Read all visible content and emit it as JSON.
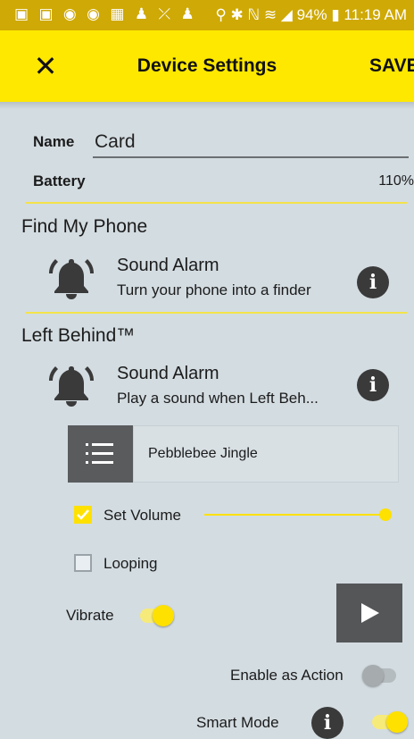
{
  "status_bar": {
    "left_icons": "▣ ▣ ◉ ◉ ▦ ♟ ⤫ ♟",
    "right_text": "⚲ ✱ ℕ ≋ ◢ 94% ▮ 11:19 AM",
    "color": "#cfa905"
  },
  "app_bar": {
    "close_icon": "✕",
    "title": "Device Settings",
    "save_label": "SAVE",
    "color": "#ffe800"
  },
  "device": {
    "name_label": "Name",
    "name_value": "Card",
    "battery_label": "Battery",
    "battery_value": "110%"
  },
  "find_my_phone": {
    "title": "Find My Phone",
    "alarm_title": "Sound Alarm",
    "alarm_subtitle": "Turn your phone into a finder",
    "info_icon": "i"
  },
  "left_behind": {
    "title": "Left Behind™",
    "alarm_title": "Sound Alarm",
    "alarm_subtitle": "Play a sound when Left Beh...",
    "info_icon": "i",
    "sound_name": "Pebblebee Jingle",
    "set_volume_label": "Set Volume",
    "set_volume_checked": true,
    "volume_level": 1.0,
    "looping_label": "Looping",
    "looping_checked": false,
    "vibrate_label": "Vibrate",
    "vibrate_on": true,
    "enable_action_label": "Enable as Action",
    "enable_action_on": false,
    "smart_mode_label": "Smart Mode",
    "smart_mode_info_icon": "i",
    "smart_mode_on": true
  },
  "colors": {
    "accent": "#ffe100",
    "background": "#d3dce1",
    "dark_button": "#595b5d"
  }
}
